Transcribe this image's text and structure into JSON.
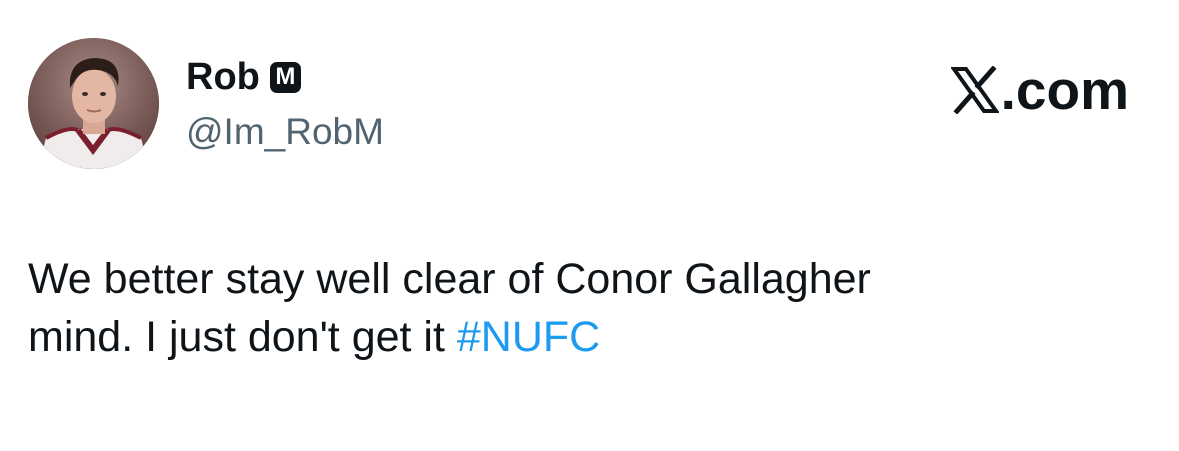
{
  "author": {
    "display_name": "Rob",
    "badge": "M",
    "handle": "@Im_RobM"
  },
  "brand": {
    "icon": "x-logo-icon",
    "suffix": ".com"
  },
  "tweet": {
    "line1": "We better stay well clear of Conor Gallagher",
    "line2": "mind. I just don't get it ",
    "hashtag": "#NUFC"
  },
  "colors": {
    "text": "#0f1419",
    "secondary": "#536471",
    "link": "#1d9bf0"
  }
}
